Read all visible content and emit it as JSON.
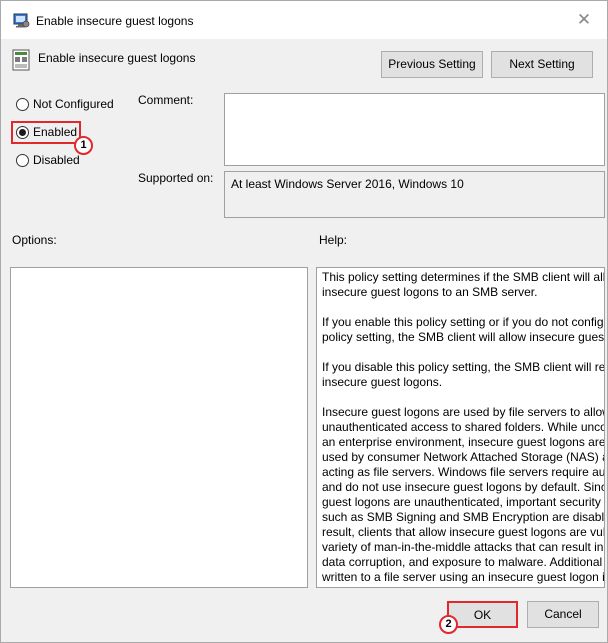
{
  "window": {
    "title": "Enable insecure guest logons",
    "close_glyph": "✕"
  },
  "policy": {
    "name": "Enable insecure guest logons"
  },
  "nav": {
    "previous_label": "Previous Setting",
    "next_label": "Next Setting"
  },
  "state": {
    "options": [
      "Not Configured",
      "Enabled",
      "Disabled"
    ],
    "selected": "Enabled"
  },
  "fields": {
    "comment_label": "Comment:",
    "comment_value": "",
    "supported_label": "Supported on:",
    "supported_value": "At least Windows Server 2016, Windows 10"
  },
  "sections": {
    "options_label": "Options:",
    "help_label": "Help:"
  },
  "help": {
    "lines": [
      [
        "This policy setting determines if the SMB client will all",
        "insecure guest logons to an SMB server."
      ],
      [
        "If you enable this policy setting or if you do not config",
        "policy setting, the SMB client will allow insecure guest"
      ],
      [
        "If you disable this policy setting, the SMB client will rej",
        "insecure guest logons."
      ],
      [
        "Insecure guest logons are used by file servers to allow",
        "unauthenticated access to shared folders. While uncor",
        "an enterprise environment, insecure guest logons are",
        "used by consumer Network Attached Storage (NAS) a",
        "acting as file servers. Windows file servers require auth",
        "and do not use insecure guest logons by default. Since",
        "guest logons are unauthenticated, important security",
        "such as SMB Signing and SMB Encryption are disablec",
        "result, clients that allow insecure guest logons are vul",
        "variety of man-in-the-middle attacks that can result in",
        "data corruption, and exposure to malware. Additional",
        "written to a file server using an insecure guest logon is"
      ]
    ]
  },
  "footer": {
    "ok_label": "OK",
    "cancel_label": "Cancel"
  },
  "annotations": {
    "step1": "1",
    "step2": "2",
    "accent": "#e0282e"
  }
}
